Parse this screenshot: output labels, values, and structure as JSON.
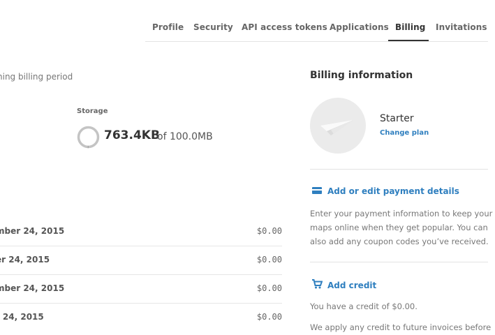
{
  "tabs": [
    {
      "label": "Profile"
    },
    {
      "label": "Security"
    },
    {
      "label": "API access tokens"
    },
    {
      "label": "Applications"
    },
    {
      "label": "Billing"
    },
    {
      "label": "Invitations"
    }
  ],
  "usage": {
    "period_text": "ning billing period",
    "storage_label": "Storage",
    "storage_used": "763.4KB",
    "storage_of": "of 100.0MB",
    "storage_fraction": 0.0076
  },
  "invoices": [
    {
      "date": "mber 24, 2015",
      "amount": "$0.00"
    },
    {
      "date": "er 24, 2015",
      "amount": "$0.00"
    },
    {
      "date": "mber 24, 2015",
      "amount": "$0.00"
    },
    {
      "date": "t 24, 2015",
      "amount": "$0.00"
    }
  ],
  "billing": {
    "title": "Billing information",
    "plan_icon": "paper-plane-icon",
    "plan_name": "Starter",
    "change_plan": "Change plan",
    "payment_link": "Add or edit payment details",
    "payment_text": "Enter your payment information to keep your maps online when they get popular. You can also add any coupon codes you’ve received.",
    "credit_link": "Add credit",
    "credit_text": "You have a credit of $0.00.",
    "credit_note": "We apply any credit to future invoices before"
  },
  "colors": {
    "link": "#2f7fbf",
    "ring": "#bdbdbd"
  }
}
